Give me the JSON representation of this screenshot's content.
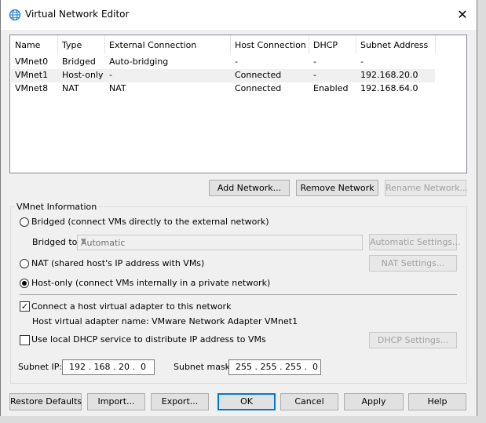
{
  "window": {
    "title": "Virtual Network Editor",
    "close_glyph": "✕"
  },
  "table": {
    "columns": [
      "Name",
      "Type",
      "External Connection",
      "Host Connection",
      "DHCP",
      "Subnet Address"
    ],
    "rows": [
      [
        "VMnet0",
        "Bridged",
        "Auto-bridging",
        "-",
        "-",
        "-"
      ],
      [
        "VMnet1",
        "Host-only",
        "-",
        "Connected",
        "-",
        "192.168.20.0"
      ],
      [
        "VMnet8",
        "NAT",
        "NAT",
        "Connected",
        "Enabled",
        "192.168.64.0"
      ]
    ]
  },
  "table_buttons": {
    "add": "Add Network...",
    "remove": "Remove Network",
    "rename": "Rename Network..."
  },
  "vmnet_info": {
    "group_title": "VMnet Information",
    "bridged_label": "Bridged (connect VMs directly to the external network)",
    "bridged_to_label": "Bridged to:",
    "bridged_to_value": "Automatic",
    "auto_settings": "Automatic Settings...",
    "nat_label": "NAT (shared host's IP address with VMs)",
    "nat_settings": "NAT Settings...",
    "hostonly_label": "Host-only (connect VMs internally in a private network)",
    "selected_mode": "host-only",
    "connect_adapter_label": "Connect a host virtual adapter to this network",
    "connect_adapter_checked": true,
    "adapter_name_label": "Host virtual adapter name: VMware Network Adapter VMnet1",
    "dhcp_label": "Use local DHCP service to distribute IP address to VMs",
    "dhcp_checked": false,
    "dhcp_settings": "DHCP Settings...",
    "subnet_ip_label": "Subnet IP:",
    "subnet_ip_value": "192 . 168 . 20 .  0",
    "subnet_mask_label": "Subnet mask:",
    "subnet_mask_value": "255 . 255 . 255 .  0"
  },
  "footer": {
    "restore": "Restore Defaults",
    "import": "Import...",
    "export": "Export...",
    "ok": "OK",
    "cancel": "Cancel",
    "apply": "Apply",
    "help": "Help"
  },
  "colors": {
    "accent": "#0078d7",
    "globe": "#1e7fcb"
  }
}
